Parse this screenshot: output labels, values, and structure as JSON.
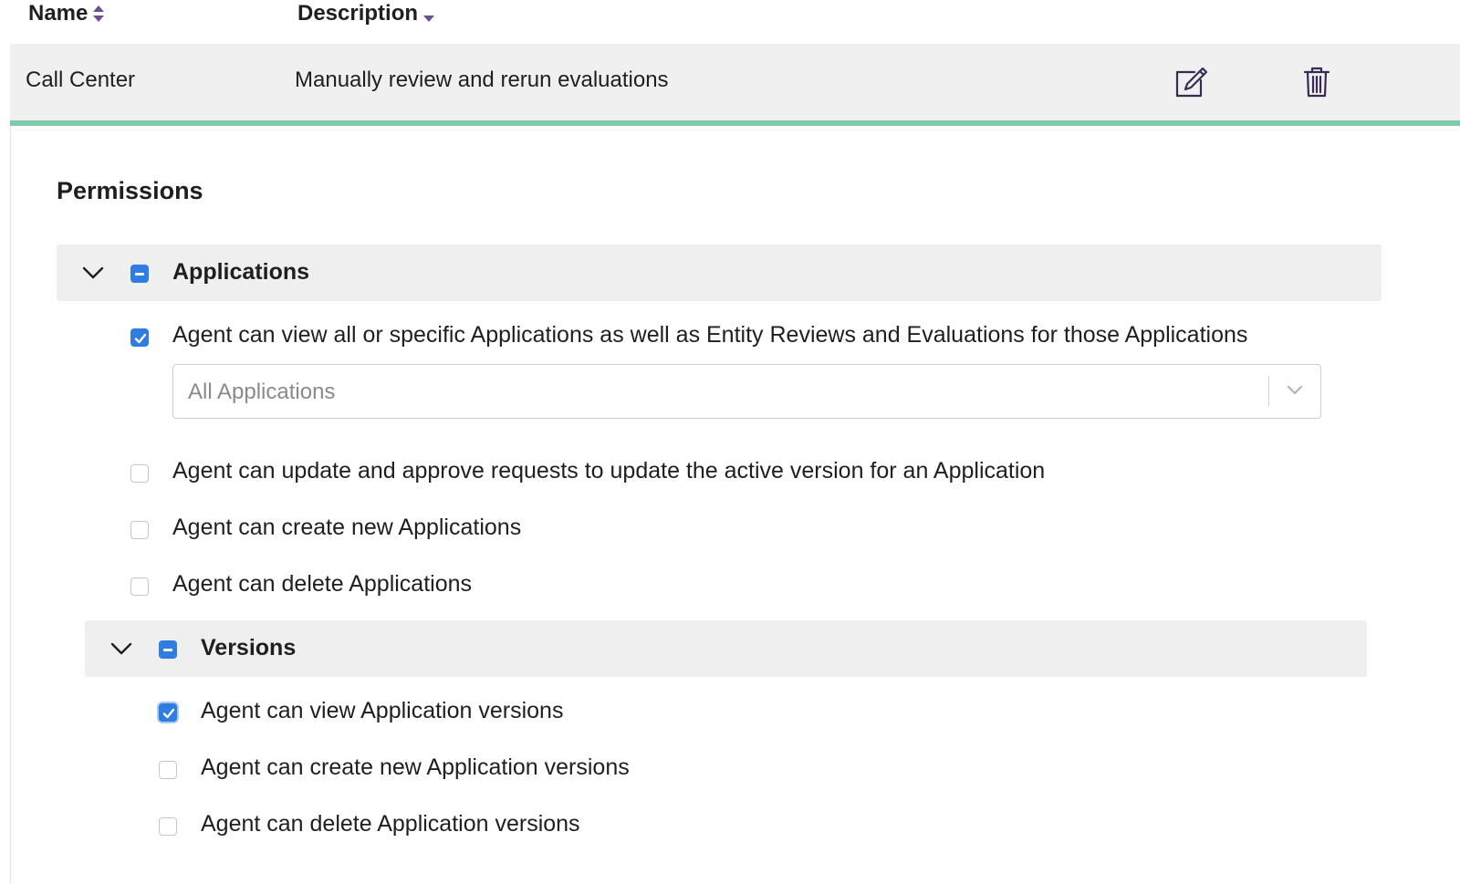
{
  "table": {
    "columns": {
      "name": "Name",
      "description": "Description"
    },
    "row": {
      "name": "Call Center",
      "description": "Manually review and rerun evaluations",
      "actions": [
        "edit-icon",
        "trash-icon"
      ]
    }
  },
  "permissions": {
    "title": "Permissions",
    "applications": {
      "label": "Applications",
      "state": "mixed",
      "expanded": true,
      "items": [
        {
          "label": "Agent can view all or specific Applications as well as Entity Reviews and Evaluations for those Applications",
          "checked": true
        },
        {
          "label": "Agent can update and approve requests to update the active version for an Application",
          "checked": false
        },
        {
          "label": "Agent can create new Applications",
          "checked": false
        },
        {
          "label": "Agent can delete Applications",
          "checked": false
        }
      ],
      "scope_select": {
        "value": "All Applications"
      }
    },
    "versions": {
      "label": "Versions",
      "state": "mixed",
      "expanded": true,
      "items": [
        {
          "label": "Agent can view Application versions",
          "checked": true
        },
        {
          "label": "Agent can create new Application versions",
          "checked": false
        },
        {
          "label": "Agent can delete Application versions",
          "checked": false
        }
      ]
    }
  },
  "colors": {
    "accent": "#2f7de1",
    "row_border": "#7fc8ac",
    "sort_icon": "#6a4f97"
  }
}
